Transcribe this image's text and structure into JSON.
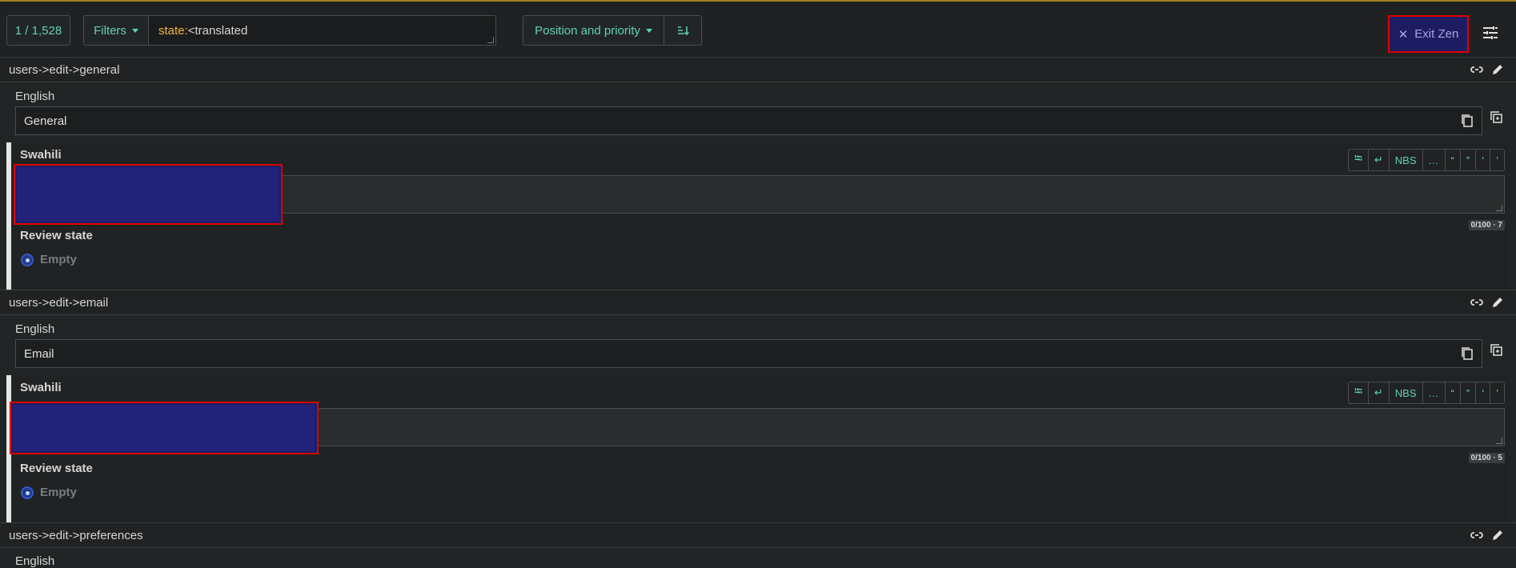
{
  "toolbar": {
    "counter": "1 / 1,528",
    "filters_label": "Filters",
    "query_key": "state:",
    "query_value": "<translated",
    "sort_label": "Position and priority",
    "exit_zen_label": "Exit Zen"
  },
  "units": [
    {
      "key": "users->edit->general",
      "source_language": "English",
      "source_text": "General",
      "target_language": "Swahili",
      "target_value": "",
      "char_counter": "0/100 · 7",
      "review_label": "Review state",
      "review_option": "Empty"
    },
    {
      "key": "users->edit->email",
      "source_language": "English",
      "source_text": "Email",
      "target_language": "Swahili",
      "target_value": "",
      "char_counter": "0/100 · 5",
      "review_label": "Review state",
      "review_option": "Empty"
    },
    {
      "key": "users->edit->preferences",
      "source_language": "English"
    }
  ],
  "chips": [
    "NBS",
    "…",
    "“",
    "”",
    "‘",
    "’"
  ],
  "colors": {
    "accent": "#5fd3b3",
    "highlight_border": "#e00000",
    "highlight_fill": "#1e1c63",
    "query_key": "#f3b53e"
  }
}
